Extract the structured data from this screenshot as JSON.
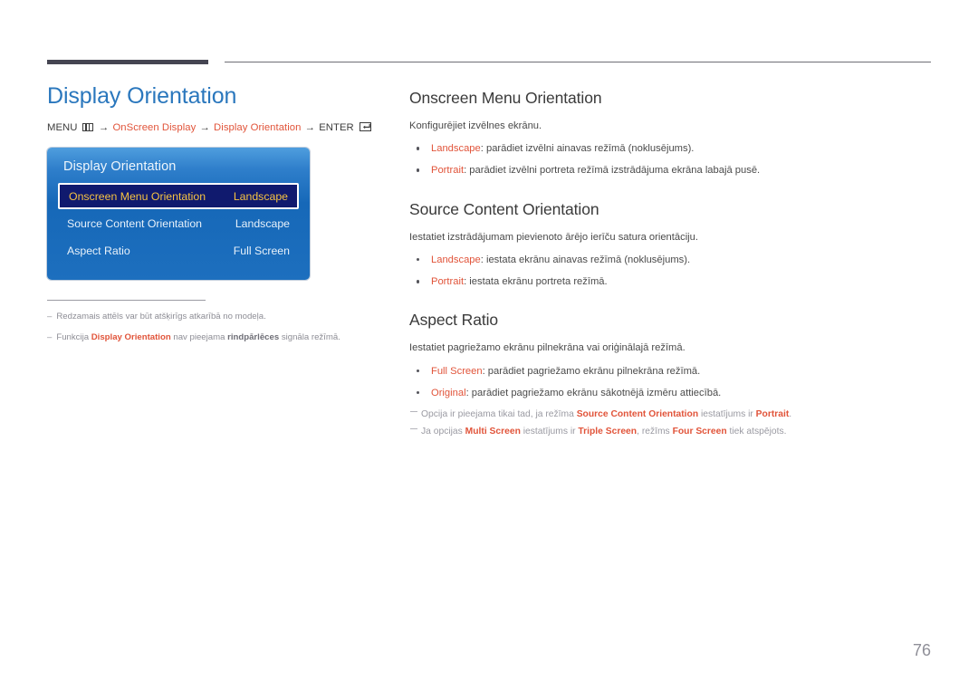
{
  "colors": {
    "accent": "#e1543a",
    "heading_blue": "#2a77bd",
    "osd_blue": "#1668b8",
    "osd_selected_bg": "#101a6e",
    "osd_selected_text": "#f6c342",
    "rule_dark": "#454552"
  },
  "left": {
    "title": "Display Orientation",
    "breadcrumb": {
      "menu_label": "MENU",
      "menu_icon": "menu-bars-icon",
      "arrow": "→",
      "item1": "OnScreen Display",
      "item2": "Display Orientation",
      "enter_label": "ENTER",
      "enter_icon": "enter-return-icon"
    },
    "osd": {
      "title": "Display Orientation",
      "rows": [
        {
          "label": "Onscreen Menu Orientation",
          "value": "Landscape",
          "selected": true
        },
        {
          "label": "Source Content Orientation",
          "value": "Landscape",
          "selected": false
        },
        {
          "label": "Aspect Ratio",
          "value": "Full Screen",
          "selected": false
        }
      ]
    },
    "footnotes": [
      {
        "dash": "–",
        "parts": [
          {
            "text": "Redzamais attēls var būt atšķirīgs atkarībā no modeļa.",
            "style": "plain"
          }
        ]
      },
      {
        "dash": "–",
        "parts": [
          {
            "text": "Funkcija ",
            "style": "plain"
          },
          {
            "text": "Display Orientation",
            "style": "accent"
          },
          {
            "text": " nav pieejama ",
            "style": "plain"
          },
          {
            "text": "rindpārlēces",
            "style": "strongish"
          },
          {
            "text": " signāla režīmā.",
            "style": "plain"
          }
        ]
      }
    ]
  },
  "right": {
    "sections": [
      {
        "title": "Onscreen Menu Orientation",
        "lead": "Konfigurējiet izvēlnes ekrānu.",
        "bullets": [
          {
            "term": "Landscape",
            "rest": ": parādiet izvēlni ainavas režīmā (noklusējums)."
          },
          {
            "term": "Portrait",
            "rest": ": parādiet izvēlni portreta režīmā izstrādājuma ekrāna labajā pusē."
          }
        ],
        "notes": []
      },
      {
        "title": "Source Content Orientation",
        "lead": "Iestatiet izstrādājumam pievienoto ārējo ierīču satura orientāciju.",
        "bullets": [
          {
            "term": "Landscape",
            "rest": ": iestata ekrānu ainavas režīmā (noklusējums)."
          },
          {
            "term": "Portrait",
            "rest": ": iestata ekrānu portreta režīmā."
          }
        ],
        "notes": []
      },
      {
        "title": "Aspect Ratio",
        "lead": "Iestatiet pagriežamo ekrānu pilnekrāna vai oriģinālajā režīmā.",
        "bullets": [
          {
            "term": "Full Screen",
            "rest": ": parādiet pagriežamo ekrānu pilnekrāna režīmā."
          },
          {
            "term": "Original",
            "rest": ": parādiet pagriežamo ekrānu sākotnējā izmēru attiecībā."
          }
        ],
        "notes": [
          {
            "parts": [
              {
                "text": "Opcija ir pieejama tikai tad, ja režīma ",
                "style": "plain"
              },
              {
                "text": "Source Content Orientation",
                "style": "accent"
              },
              {
                "text": " iestatījums ir ",
                "style": "plain"
              },
              {
                "text": "Portrait",
                "style": "accent"
              },
              {
                "text": ".",
                "style": "plain"
              }
            ]
          },
          {
            "parts": [
              {
                "text": "Ja opcijas ",
                "style": "plain"
              },
              {
                "text": "Multi Screen",
                "style": "accent"
              },
              {
                "text": " iestatījums ir ",
                "style": "plain"
              },
              {
                "text": "Triple Screen",
                "style": "accent"
              },
              {
                "text": ", režīms ",
                "style": "plain"
              },
              {
                "text": "Four Screen",
                "style": "accent"
              },
              {
                "text": " tiek atspējots.",
                "style": "plain"
              }
            ]
          }
        ]
      }
    ]
  },
  "page_number": "76"
}
